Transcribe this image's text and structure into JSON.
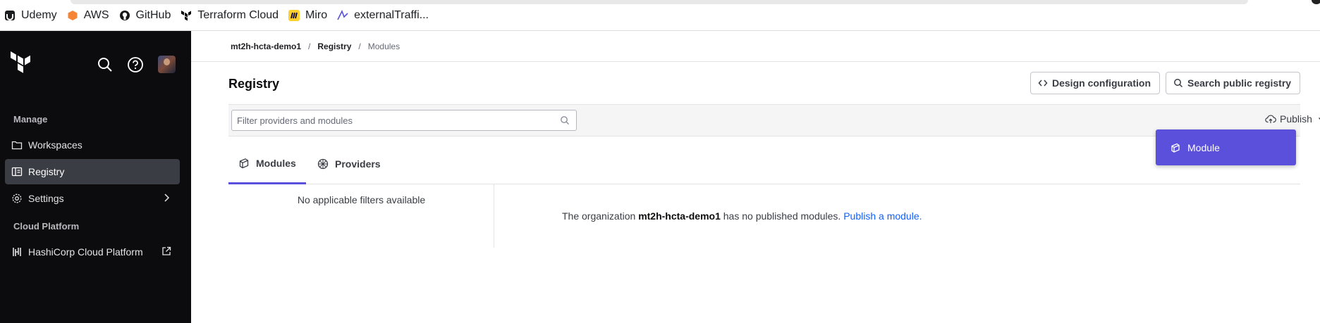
{
  "bookmarks": [
    {
      "label": "Udemy",
      "icon": "udemy-icon"
    },
    {
      "label": "AWS",
      "icon": "aws-icon"
    },
    {
      "label": "GitHub",
      "icon": "github-icon"
    },
    {
      "label": "Terraform Cloud",
      "icon": "terraform-icon"
    },
    {
      "label": "Miro",
      "icon": "miro-icon"
    },
    {
      "label": "externalTraffi...",
      "icon": "external-traffic-icon"
    }
  ],
  "sidebar": {
    "manage_heading": "Manage",
    "items": [
      {
        "label": "Workspaces",
        "icon": "folder-icon"
      },
      {
        "label": "Registry",
        "icon": "registry-icon",
        "active": true
      },
      {
        "label": "Settings",
        "icon": "gear-icon"
      }
    ],
    "cloud_heading": "Cloud Platform",
    "cloud_item": {
      "label": "HashiCorp Cloud Platform",
      "icon": "hashicorp-icon"
    }
  },
  "breadcrumb": {
    "org": "mt2h-hcta-demo1",
    "section": "Registry",
    "current": "Modules",
    "separator": "/"
  },
  "page": {
    "title": "Registry",
    "design_button": "Design configuration",
    "search_button": "Search public registry",
    "filter_placeholder": "Filter providers and modules",
    "publish_label": "Publish",
    "publish_menu_item": "Module"
  },
  "tabs": [
    {
      "label": "Modules",
      "icon": "module-icon",
      "active": true
    },
    {
      "label": "Providers",
      "icon": "provider-icon"
    }
  ],
  "content": {
    "no_filters": "No applicable filters available",
    "empty_prefix": "The organization ",
    "empty_org": "mt2h-hcta-demo1",
    "empty_suffix": " has no published modules. ",
    "publish_link": "Publish a module."
  },
  "colors": {
    "sidebar_bg": "#0c0c0e",
    "accent": "#5b50db",
    "link": "#1060ff"
  }
}
